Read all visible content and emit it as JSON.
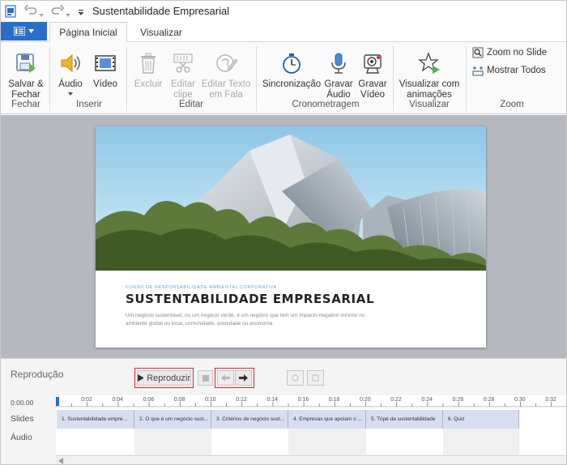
{
  "titlebar": {
    "title": "Sustentabilidade Empresarial"
  },
  "tabs": {
    "home": "Página Inicial",
    "view": "Visualizar"
  },
  "ribbon": {
    "fechar": {
      "save_close": "Salvar &\nFechar",
      "group": "Fechar"
    },
    "inserir": {
      "audio": "Áudio",
      "video": "Vídeo",
      "group": "Inserir"
    },
    "editar": {
      "delete": "Excluir",
      "edit_clip": "Editar\nclipe",
      "edit_tts": "Editar Texto\nem Fala",
      "group": "Editar"
    },
    "cronometragem": {
      "sync": "Sincronização",
      "rec_audio": "Gravar\nÁudio",
      "rec_video": "Gravar\nVídeo",
      "group": "Cronometragem"
    },
    "visualizar": {
      "preview": "Visualizar com\nanimações",
      "group": "Visualizar"
    },
    "zoom": {
      "zoom_slide": "Zoom no Slide",
      "show_all": "Mostrar Todos",
      "group": "Zoom"
    }
  },
  "slide": {
    "subtitle": "CURSO DE RESPONSABILIDADE AMBIENTAL CORPORATIVA",
    "title": "SUSTENTABILIDADE EMPRESARIAL",
    "description": "Um negócio sustentável, ou um negócio verde, é um negócio que tem um impacto negativo mínimo no ambiente global ou local, comunidade, sociedade ou economia."
  },
  "playback": {
    "label": "Reprodução",
    "play": "Reproduzir"
  },
  "timeline": {
    "start": "0:00.00",
    "ticks": [
      "0:02",
      "0:04",
      "0:06",
      "0:08",
      "0:10",
      "0:12",
      "0:14",
      "0:16",
      "0:18",
      "0:20",
      "0:22",
      "0:24",
      "0:26",
      "0:28",
      "0:30",
      "0:32"
    ],
    "rows": {
      "slides": "Slides",
      "audio": "Áudio"
    },
    "segments": [
      "1. Sustentabilidade empre...",
      "2. O que é um negócio sust...",
      "3. Critérios de negócio sust...",
      "4. Empresas que apoiam o ...",
      "5. Tripé da sustentabilidade",
      "6. Quiz"
    ]
  }
}
